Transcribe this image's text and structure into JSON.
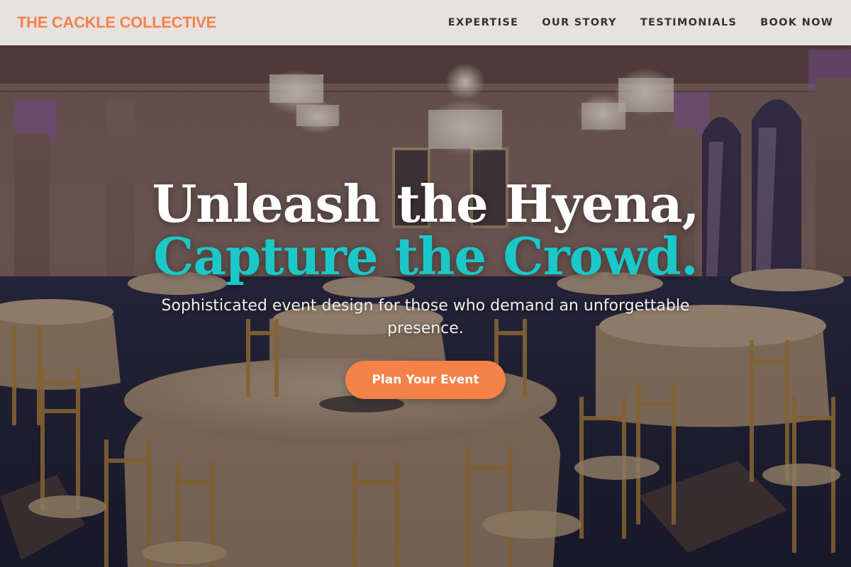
{
  "brand": {
    "name": "THE CACKLE COLLECTIVE",
    "color": "#f48249"
  },
  "nav": {
    "items": [
      {
        "label": "EXPERTISE"
      },
      {
        "label": "OUR STORY"
      },
      {
        "label": "TESTIMONIALS"
      },
      {
        "label": "BOOK NOW"
      }
    ]
  },
  "hero": {
    "headline_line1": "Unleash the Hyena,",
    "headline_line2": "Capture the Crowd.",
    "headline_line2_color": "#1ac8c8",
    "subtitle": "Sophisticated event design for those who demand an unforgettable presence.",
    "cta_label": "Plan Your Event",
    "cta_color": "#f48249"
  }
}
